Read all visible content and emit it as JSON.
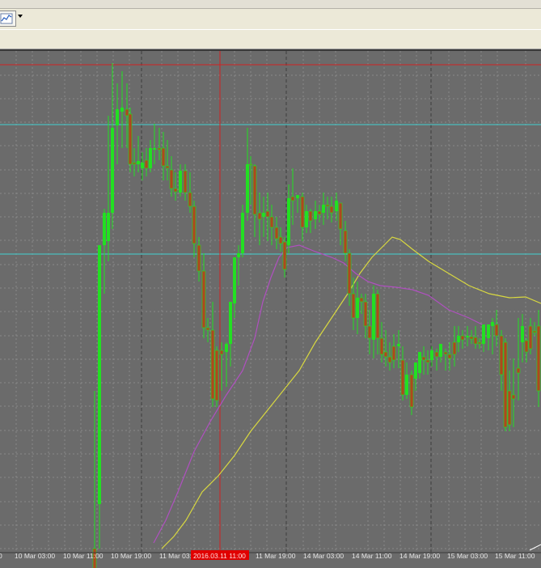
{
  "toolbar": {
    "chart_type_icon": "line-chart-icon",
    "dropdown_icon": "caret-down-icon"
  },
  "chart_data": {
    "type": "candlestick",
    "x_tick_labels": [
      "10 Mar 03:00",
      "10 Mar 11:00",
      "10 Mar 19:00",
      "11 Mar 03:00",
      "11 Mar 19:00",
      "14 Mar 03:00",
      "14 Mar 11:00",
      "14 Mar 19:00",
      "15 Mar 03:00",
      "15 Mar 11:00"
    ],
    "x_tick_partial_label": "0",
    "crosshair_time_label": "2016.03.11 11:00",
    "colors": {
      "background": "#6b6b6b",
      "bull_candle": "#22e022",
      "bear_candle": "#b0461e",
      "ma_fast": "#b050c0",
      "ma_slow": "#d8d840",
      "horizontal_levels": "#40d0d0",
      "crosshair": "#d02020",
      "grid": "#8a8a8a"
    }
  }
}
